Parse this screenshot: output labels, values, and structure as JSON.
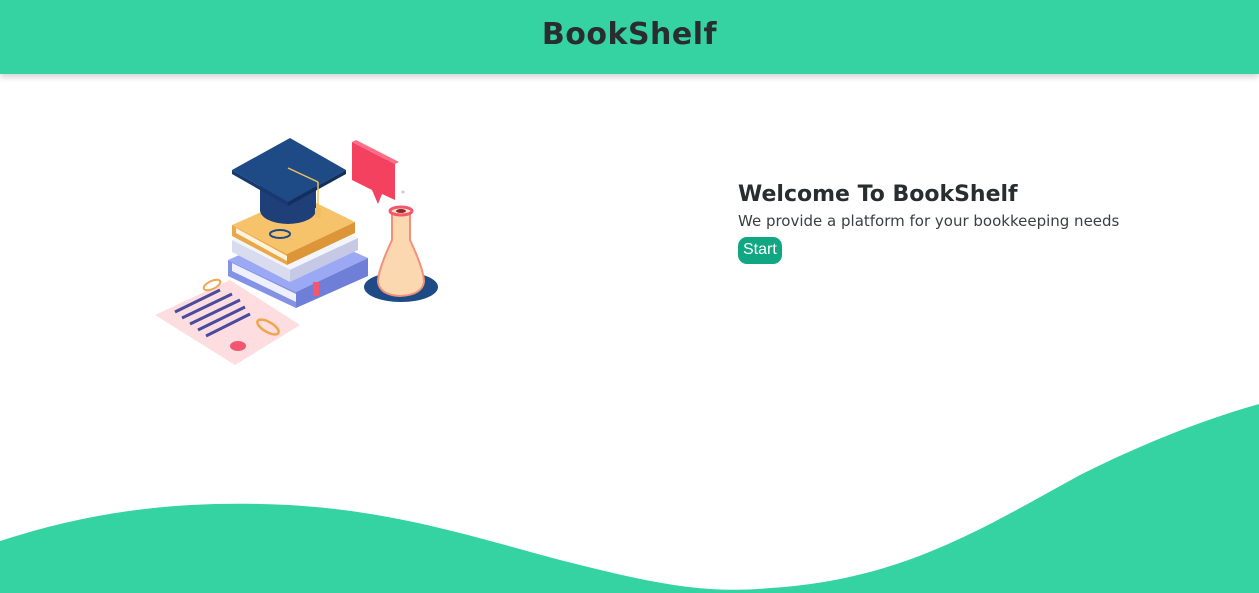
{
  "header": {
    "title": "BookShelf"
  },
  "hero": {
    "title": "Welcome To BookShelf",
    "subtitle": "We provide a platform for your bookkeeping needs",
    "start_label": "Start"
  },
  "colors": {
    "brand": "#34d3a1",
    "button": "#11a783",
    "text_dark": "#2a2d2f"
  },
  "icons": {
    "illustration": "graduation-books-flask-illustration"
  }
}
